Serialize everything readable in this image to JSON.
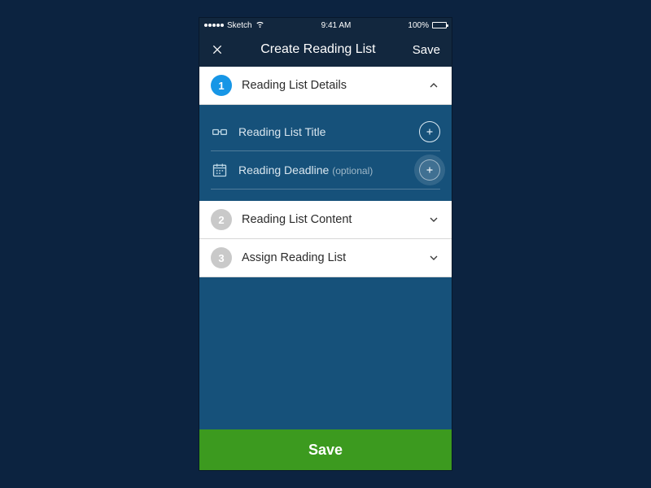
{
  "statusbar": {
    "carrier": "Sketch",
    "time": "9:41 AM",
    "battery_pct": "100%"
  },
  "navbar": {
    "title": "Create Reading List",
    "save": "Save"
  },
  "sections": {
    "s1": {
      "num": "1",
      "label": "Reading List Details"
    },
    "s2": {
      "num": "2",
      "label": "Reading List Content"
    },
    "s3": {
      "num": "3",
      "label": "Assign Reading List"
    }
  },
  "rows": {
    "title": {
      "label": "Reading List Title"
    },
    "deadline": {
      "label": "Reading Deadline ",
      "optional": "(optional)"
    }
  },
  "footer": {
    "save": "Save"
  }
}
